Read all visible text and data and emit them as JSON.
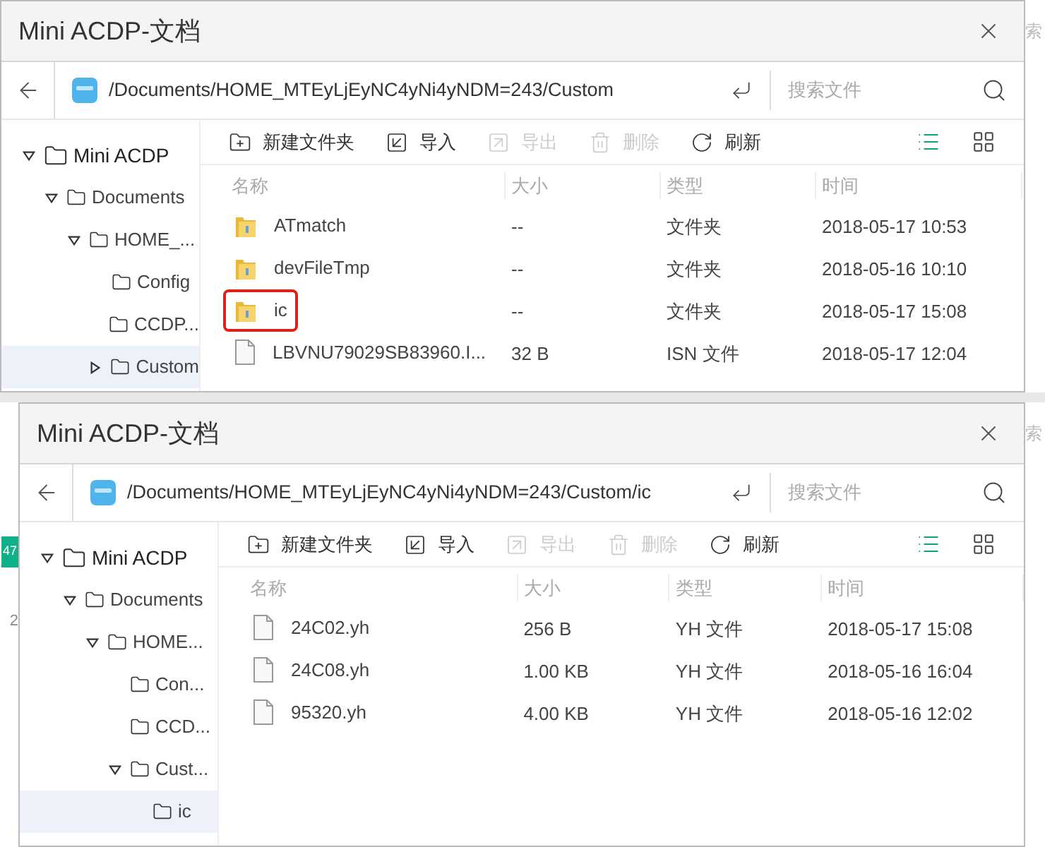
{
  "screens": [
    {
      "backdrop": {
        "right_text": "索"
      },
      "window": {
        "title": "Mini ACDP-文档",
        "path": "/Documents/HOME_MTEyLjEyNC4yNi4yNDM=243/Custom",
        "search": {
          "placeholder": "搜索文件"
        },
        "tree": [
          {
            "name": "Mini ACDP",
            "expanded": true,
            "selected": false,
            "children": [
              {
                "name": "Documents",
                "expanded": true,
                "selected": false,
                "children": [
                  {
                    "name": "HOME_...",
                    "expanded": true,
                    "selected": false,
                    "children": [
                      {
                        "name": "Config",
                        "selected": false
                      },
                      {
                        "name": "CCDP...",
                        "selected": false
                      },
                      {
                        "name": "Custom",
                        "expanded": false,
                        "selected": true
                      }
                    ]
                  }
                ]
              }
            ]
          }
        ],
        "toolbar": [
          {
            "kind": "new-folder",
            "label": "新建文件夹",
            "disabled": false
          },
          {
            "kind": "import",
            "label": "导入",
            "disabled": false
          },
          {
            "kind": "export",
            "label": "导出",
            "disabled": true
          },
          {
            "kind": "delete",
            "label": "删除",
            "disabled": true
          },
          {
            "kind": "refresh",
            "label": "刷新",
            "disabled": false
          }
        ],
        "view_modes": [
          {
            "kind": "list",
            "selected": true
          },
          {
            "kind": "grid",
            "selected": false
          }
        ],
        "columns": [
          "名称",
          "大小",
          "类型",
          "时间"
        ],
        "rows": [
          {
            "kind": "folder",
            "name": "ATmatch",
            "size": "--",
            "type": "文件夹",
            "time": "2018-05-17 10:53",
            "highlighted": false
          },
          {
            "kind": "folder",
            "name": "devFileTmp",
            "size": "--",
            "type": "文件夹",
            "time": "2018-05-16 10:10",
            "highlighted": false
          },
          {
            "kind": "folder",
            "name": "ic",
            "size": "--",
            "type": "文件夹",
            "time": "2018-05-17 15:08",
            "highlighted": true
          },
          {
            "kind": "file",
            "name": "LBVNU79029SB83960.I...",
            "size": "32 B",
            "type": "ISN 文件",
            "time": "2018-05-17 12:04",
            "highlighted": false
          }
        ]
      }
    },
    {
      "backdrop": {
        "right_text": "索",
        "left_badge": "47",
        "left_text": "2"
      },
      "window": {
        "title": "Mini ACDP-文档",
        "path": "/Documents/HOME_MTEyLjEyNC4yNi4yNDM=243/Custom/ic",
        "search": {
          "placeholder": "搜索文件"
        },
        "tree": [
          {
            "name": "Mini ACDP",
            "expanded": true,
            "selected": false,
            "children": [
              {
                "name": "Documents",
                "expanded": true,
                "selected": false,
                "children": [
                  {
                    "name": "HOME...",
                    "expanded": true,
                    "selected": false,
                    "children": [
                      {
                        "name": "Con...",
                        "selected": false
                      },
                      {
                        "name": "CCD...",
                        "selected": false
                      },
                      {
                        "name": "Cust...",
                        "expanded": true,
                        "selected": false,
                        "children": [
                          {
                            "name": "ic",
                            "selected": true
                          }
                        ]
                      }
                    ]
                  }
                ]
              }
            ]
          }
        ],
        "toolbar": [
          {
            "kind": "new-folder",
            "label": "新建文件夹",
            "disabled": false
          },
          {
            "kind": "import",
            "label": "导入",
            "disabled": false
          },
          {
            "kind": "export",
            "label": "导出",
            "disabled": true
          },
          {
            "kind": "delete",
            "label": "删除",
            "disabled": true
          },
          {
            "kind": "refresh",
            "label": "刷新",
            "disabled": false
          }
        ],
        "view_modes": [
          {
            "kind": "list",
            "selected": true
          },
          {
            "kind": "grid",
            "selected": false
          }
        ],
        "columns": [
          "名称",
          "大小",
          "类型",
          "时间"
        ],
        "rows": [
          {
            "kind": "file",
            "name": "24C02.yh",
            "size": "256 B",
            "type": "YH 文件",
            "time": "2018-05-17 15:08",
            "highlighted": false
          },
          {
            "kind": "file",
            "name": "24C08.yh",
            "size": "1.00 KB",
            "type": "YH 文件",
            "time": "2018-05-16 16:04",
            "highlighted": false
          },
          {
            "kind": "file",
            "name": "95320.yh",
            "size": "4.00 KB",
            "type": "YH 文件",
            "time": "2018-05-16 12:02",
            "highlighted": false
          }
        ]
      }
    }
  ]
}
